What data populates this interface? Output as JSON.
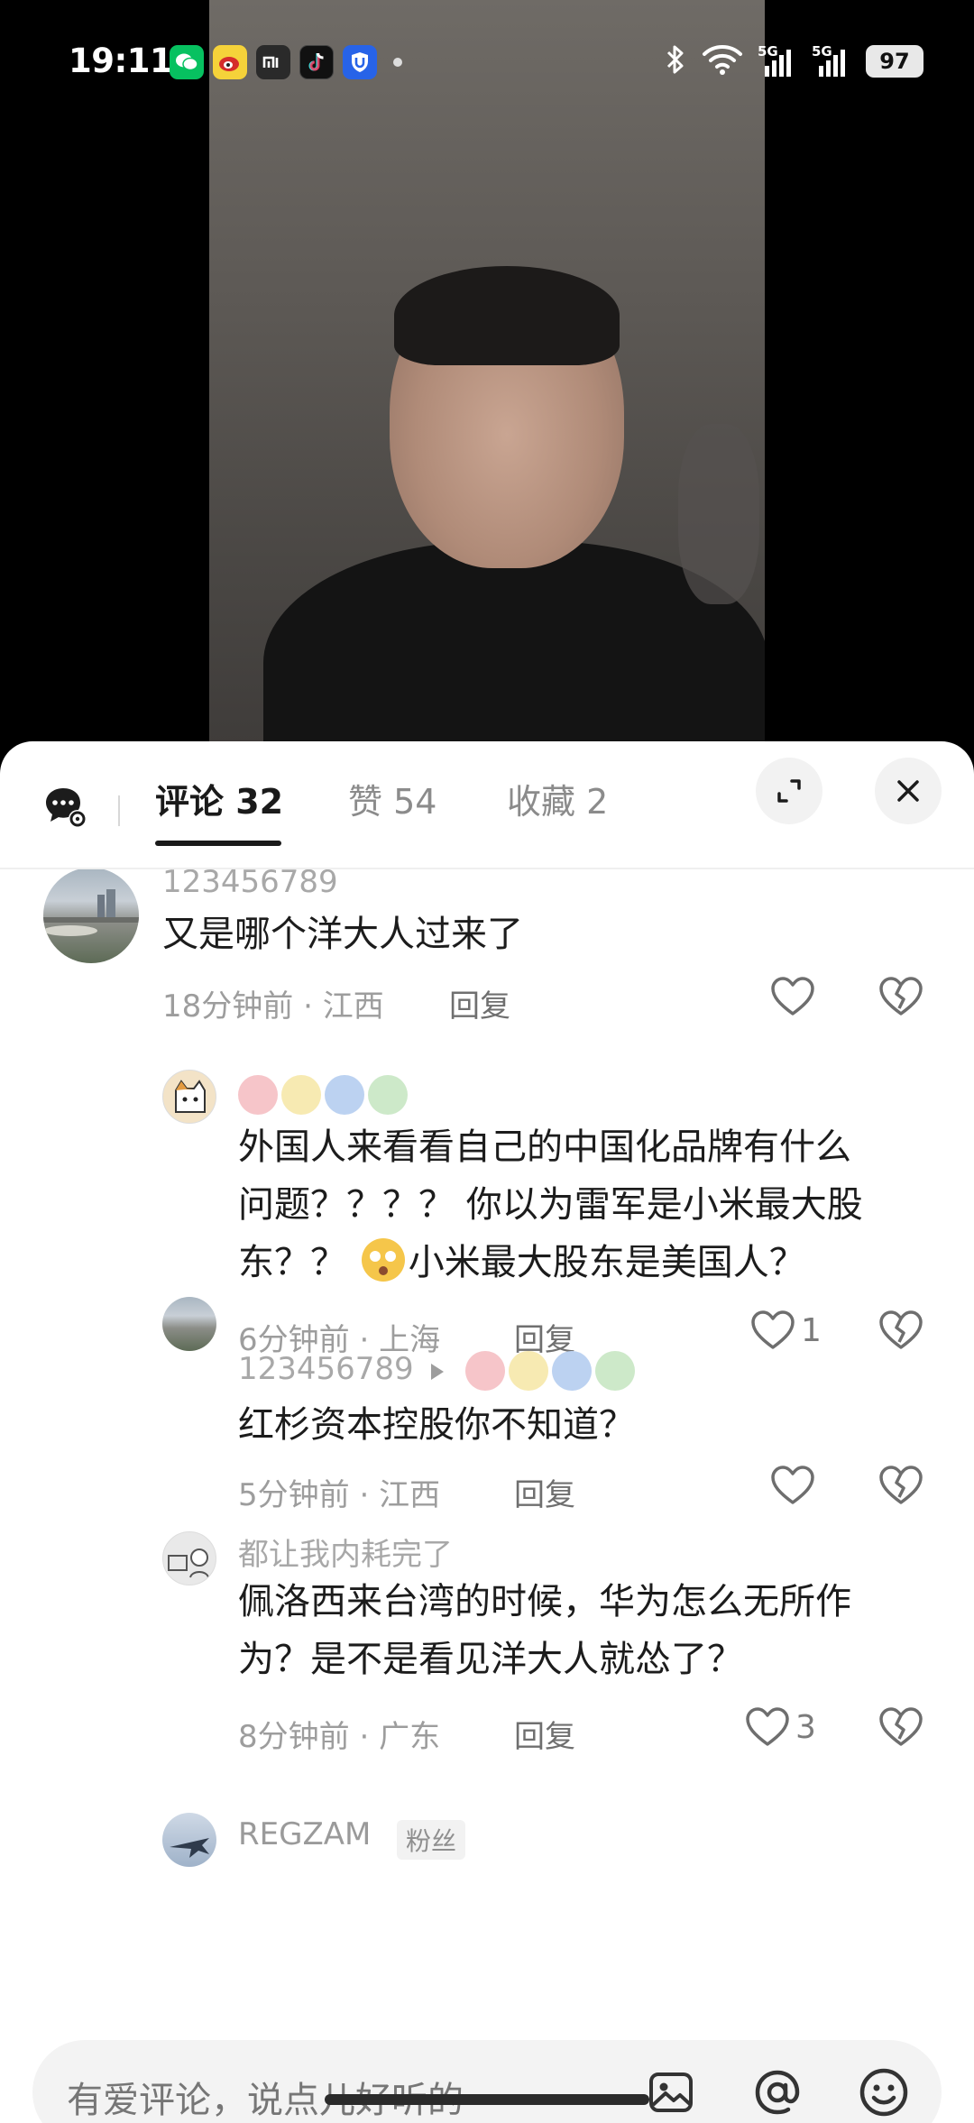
{
  "status_bar": {
    "time": "19:11",
    "battery": "97",
    "network1": "5G",
    "network2": "5G"
  },
  "header": {
    "tabs": [
      {
        "label": "评论 32"
      },
      {
        "label": "赞 54"
      },
      {
        "label": "收藏 2"
      }
    ]
  },
  "comments": [
    {
      "user": "123456789",
      "text_lines": [
        "又是哪个洋大人过来了"
      ],
      "time": "18分钟前",
      "location": "江西",
      "reply": "回复",
      "likes": ""
    },
    {
      "user": "",
      "text_lines": [
        "外国人来看看自己的中国化品牌有什么",
        "问题？？？？ 你以为雷军是小米最大股"
      ],
      "line3_a": "东？？",
      "line3_b": "小米最大股东是美国人？",
      "time": "6分钟前",
      "location": "上海",
      "reply": "回复",
      "likes": "1"
    },
    {
      "user": "123456789",
      "text_lines": [
        "红杉资本控股你不知道？"
      ],
      "time": "5分钟前",
      "location": "江西",
      "reply": "回复",
      "likes": ""
    },
    {
      "user": "都让我内耗完了",
      "text_lines": [
        "佩洛西来台湾的时候，华为怎么无所作",
        "为？是不是看见洋大人就怂了？"
      ],
      "time": "8分钟前",
      "location": "广东",
      "reply": "回复",
      "likes": "3"
    },
    {
      "user": "REGZAM",
      "tag": "粉丝"
    }
  ],
  "input": {
    "placeholder": "有爱评论，说点儿好听的"
  },
  "icons": [
    "wechat-icon",
    "weibo-icon",
    "mi-icon",
    "tiktok-icon",
    "shield-icon",
    "bluetooth-icon",
    "wifi-icon",
    "chat-settings-icon",
    "expand-icon",
    "close-icon",
    "heart-icon",
    "broken-heart-icon",
    "image-icon",
    "at-icon",
    "emoji-icon"
  ]
}
